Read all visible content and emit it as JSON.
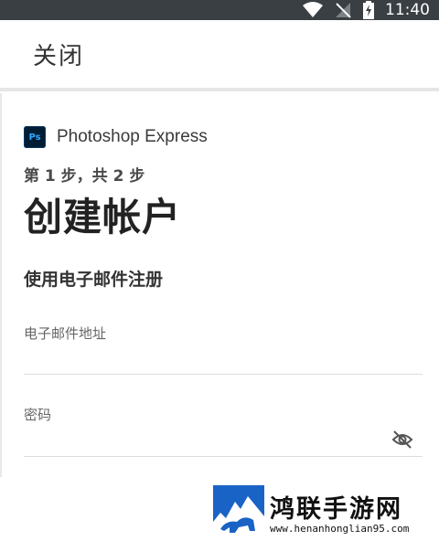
{
  "status_bar": {
    "time": "11:40",
    "icons": [
      "wifi-icon",
      "no-sim-icon",
      "battery-charging-icon"
    ]
  },
  "app_bar": {
    "close_label": "关闭"
  },
  "brand": {
    "logo_text": "Ps",
    "name": "Photoshop Express"
  },
  "form": {
    "step": "第 1 步，共 2 步",
    "title": "创建帐户",
    "subtitle": "使用电子邮件注册",
    "email": {
      "label": "电子邮件地址",
      "value": ""
    },
    "password": {
      "label": "密码",
      "value": "",
      "toggle_icon": "eye-off-icon"
    }
  },
  "watermark": {
    "title": "鸿联手游网",
    "url": "www.henanhonglian95.com"
  },
  "colors": {
    "status_bar": "#3a3f44",
    "ps_logo_bg": "#001d34",
    "ps_logo_text": "#31a8ff",
    "watermark_blue": "#1a63c6"
  }
}
